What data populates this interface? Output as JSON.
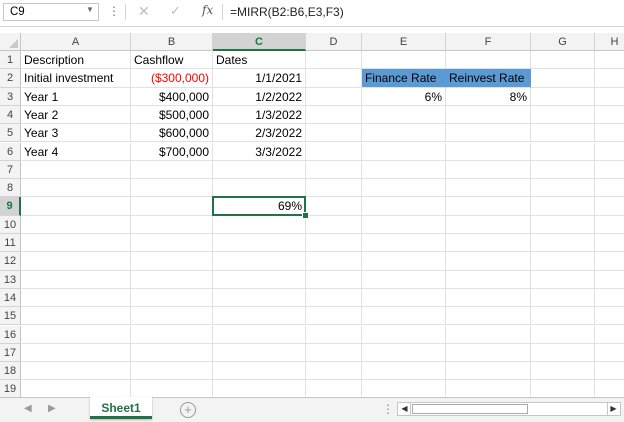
{
  "formula_bar": {
    "name_box": "C9",
    "fx": "fx",
    "formula": "=MIRR(B2:B6,E3,F3)",
    "cancel_icon": "✕",
    "enter_icon": "✓"
  },
  "columns": [
    "A",
    "B",
    "C",
    "D",
    "E",
    "F",
    "G",
    "H"
  ],
  "selected_column": "C",
  "rows": [
    "1",
    "2",
    "3",
    "4",
    "5",
    "6",
    "7",
    "8",
    "9",
    "10",
    "11",
    "12",
    "13",
    "14",
    "15",
    "16",
    "17",
    "18",
    "19"
  ],
  "selected_row": "9",
  "cells": {
    "A1": "Description",
    "B1": "Cashflow",
    "C1": "Dates",
    "A2": "Initial investment",
    "B2": "($300,000)",
    "C2": "1/1/2021",
    "A3": "Year 1",
    "B3": "$400,000",
    "C3": "1/2/2022",
    "A4": "Year 2",
    "B4": "$500,000",
    "C4": "1/3/2022",
    "A5": "Year 3",
    "B5": "$600,000",
    "C5": "2/3/2022",
    "A6": "Year 4",
    "B6": "$700,000",
    "C6": "3/3/2022",
    "E2": "Finance Rate",
    "F2": "Reinvest Rate",
    "E3": "6%",
    "F3": "8%",
    "C9": "69%"
  },
  "colors": {
    "header_fill": "#5b9bd5",
    "negative": "#ff0000",
    "accent": "#217346"
  },
  "sheet_tabs": [
    "Sheet1"
  ],
  "active_sheet": "Sheet1",
  "add_sheet_icon": "+",
  "icons": {
    "namebox_arrow": "chevron-down-icon",
    "cancel": "close-icon",
    "enter": "check-icon",
    "function": "fx-icon",
    "add_sheet": "plus-circle-icon"
  }
}
